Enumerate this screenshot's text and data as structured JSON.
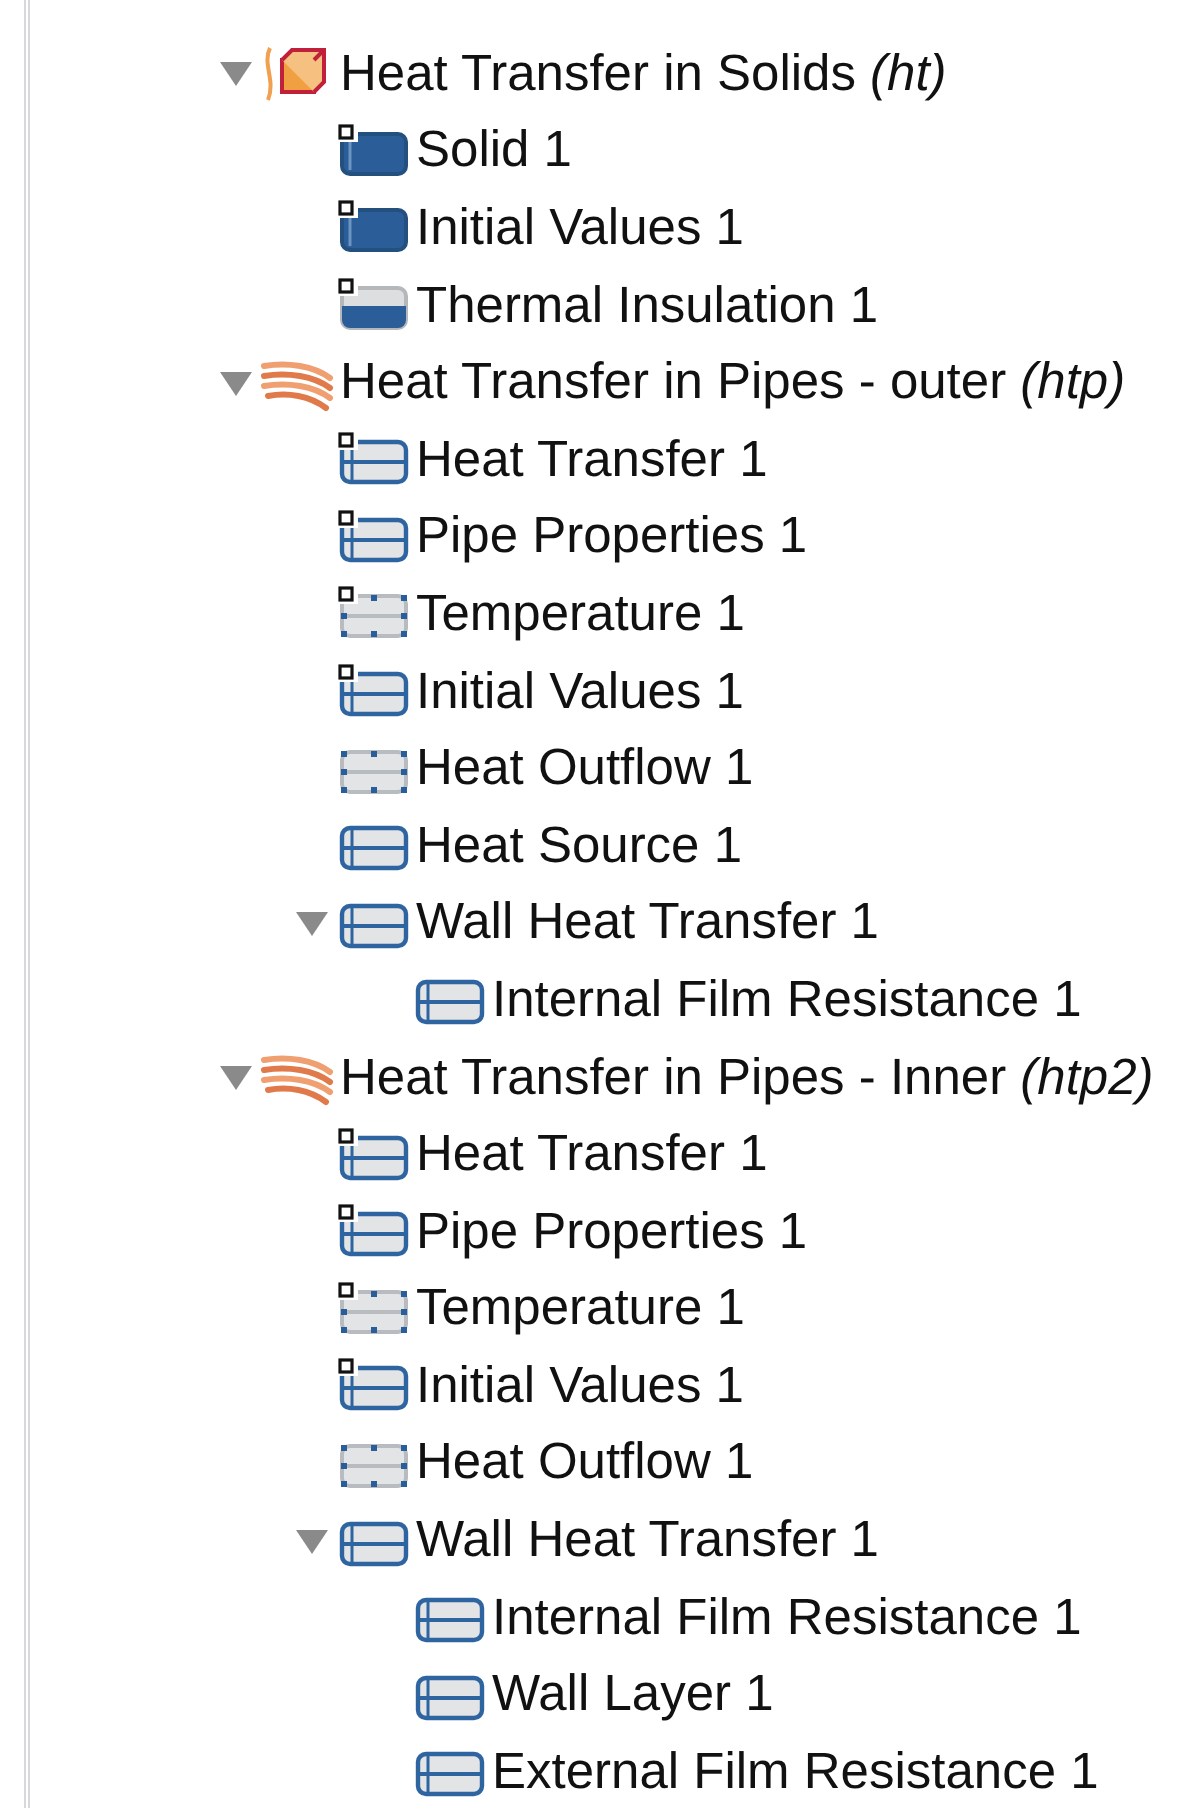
{
  "tree": [
    {
      "label": "Heat Transfer in Solids *(ht)*",
      "kind": "solids",
      "expanded": true,
      "children": [
        {
          "label": "Solid 1",
          "kind": "filled",
          "default": true
        },
        {
          "label": "Initial Values 1",
          "kind": "filled",
          "default": true
        },
        {
          "label": "Thermal Insulation 1",
          "kind": "half",
          "default": true
        }
      ]
    },
    {
      "label": "Heat Transfer in Pipes - outer *(htp)*",
      "kind": "pipes",
      "expanded": true,
      "children": [
        {
          "label": "Heat Transfer 1",
          "kind": "outline",
          "default": true
        },
        {
          "label": "Pipe Properties 1",
          "kind": "outline",
          "default": true
        },
        {
          "label": "Temperature 1",
          "kind": "dotted",
          "default": true
        },
        {
          "label": "Initial Values 1",
          "kind": "outline",
          "default": true
        },
        {
          "label": "Heat Outflow 1",
          "kind": "dotted",
          "default": false
        },
        {
          "label": "Heat Source 1",
          "kind": "outline",
          "default": false
        },
        {
          "label": "Wall Heat Transfer 1",
          "kind": "outline",
          "default": false,
          "expanded": true,
          "children": [
            {
              "label": "Internal Film Resistance 1",
              "kind": "outline",
              "default": false
            }
          ]
        }
      ]
    },
    {
      "label": "Heat Transfer in Pipes - Inner *(htp2)*",
      "kind": "pipes",
      "expanded": true,
      "children": [
        {
          "label": "Heat Transfer 1",
          "kind": "outline",
          "default": true
        },
        {
          "label": "Pipe Properties 1",
          "kind": "outline",
          "default": true
        },
        {
          "label": "Temperature 1",
          "kind": "dotted",
          "default": true
        },
        {
          "label": "Initial Values 1",
          "kind": "outline",
          "default": true
        },
        {
          "label": "Heat Outflow 1",
          "kind": "dotted",
          "default": false
        },
        {
          "label": "Wall Heat Transfer 1",
          "kind": "outline",
          "default": false,
          "expanded": true,
          "children": [
            {
              "label": "Internal Film Resistance 1",
              "kind": "outline",
              "default": false
            },
            {
              "label": "Wall Layer 1",
              "kind": "outline",
              "default": false
            },
            {
              "label": "External Film Resistance 1",
              "kind": "outline",
              "default": false
            }
          ]
        }
      ]
    }
  ]
}
